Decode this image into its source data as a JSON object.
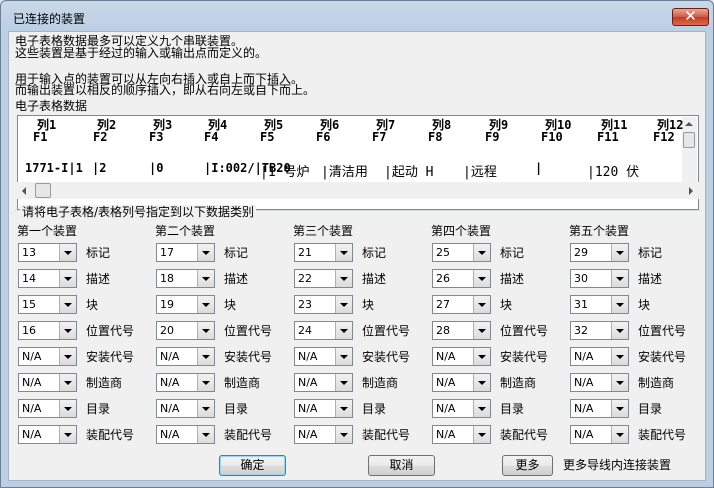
{
  "window": {
    "title": "已连接的装置",
    "close_glyph": "✕"
  },
  "intro": {
    "line1": "电子表格数据最多可以定义九个串联装置。",
    "line2": "这些装置是基于经过的输入或输出点而定义的。",
    "line3": "用于输入点的装置可以从左向右插入或自上而下插入。",
    "line4": "而输出装置以相反的顺序插入，即从右向左或自下而上。"
  },
  "spreadsheet": {
    "label": "电子表格数据",
    "columns": [
      {
        "col": "列1",
        "field": "F1"
      },
      {
        "col": "列2",
        "field": "F2"
      },
      {
        "col": "列3",
        "field": "F3"
      },
      {
        "col": "列4",
        "field": "F4"
      },
      {
        "col": "列5",
        "field": "F5"
      },
      {
        "col": "列6",
        "field": "F6"
      },
      {
        "col": "列7",
        "field": "F7"
      },
      {
        "col": "列8",
        "field": "F8"
      },
      {
        "col": "列9",
        "field": "F9"
      },
      {
        "col": "列10",
        "field": "F10"
      },
      {
        "col": "列11",
        "field": "F11"
      },
      {
        "col": "列12",
        "field": "F12"
      }
    ],
    "row": [
      "1771-I|1",
      "|2",
      "|0",
      "|I:002/|TB20",
      "|1 号炉",
      "|清洁用",
      "|起动 H",
      "|远程",
      "|",
      "|120 伏"
    ]
  },
  "assign_label": "请将电子表格/表格列号指定到以下数据类别",
  "devices": [
    {
      "header": "第一个装置",
      "values": [
        "13",
        "14",
        "15",
        "16",
        "N/A",
        "N/A",
        "N/A",
        "N/A"
      ]
    },
    {
      "header": "第二个装置",
      "values": [
        "17",
        "18",
        "19",
        "20",
        "N/A",
        "N/A",
        "N/A",
        "N/A"
      ]
    },
    {
      "header": "第三个装置",
      "values": [
        "21",
        "22",
        "23",
        "24",
        "N/A",
        "N/A",
        "N/A",
        "N/A"
      ]
    },
    {
      "header": "第四个装置",
      "values": [
        "25",
        "26",
        "27",
        "28",
        "N/A",
        "N/A",
        "N/A",
        "N/A"
      ]
    },
    {
      "header": "第五个装置",
      "values": [
        "29",
        "30",
        "31",
        "32",
        "N/A",
        "N/A",
        "N/A",
        "N/A"
      ]
    }
  ],
  "categories": [
    "标记",
    "描述",
    "块",
    "位置代号",
    "安装代号",
    "制造商",
    "目录",
    "装配代号"
  ],
  "buttons": {
    "ok": "确定",
    "cancel": "取消",
    "more": "更多"
  },
  "more_hint": "更多导线内连接装置"
}
